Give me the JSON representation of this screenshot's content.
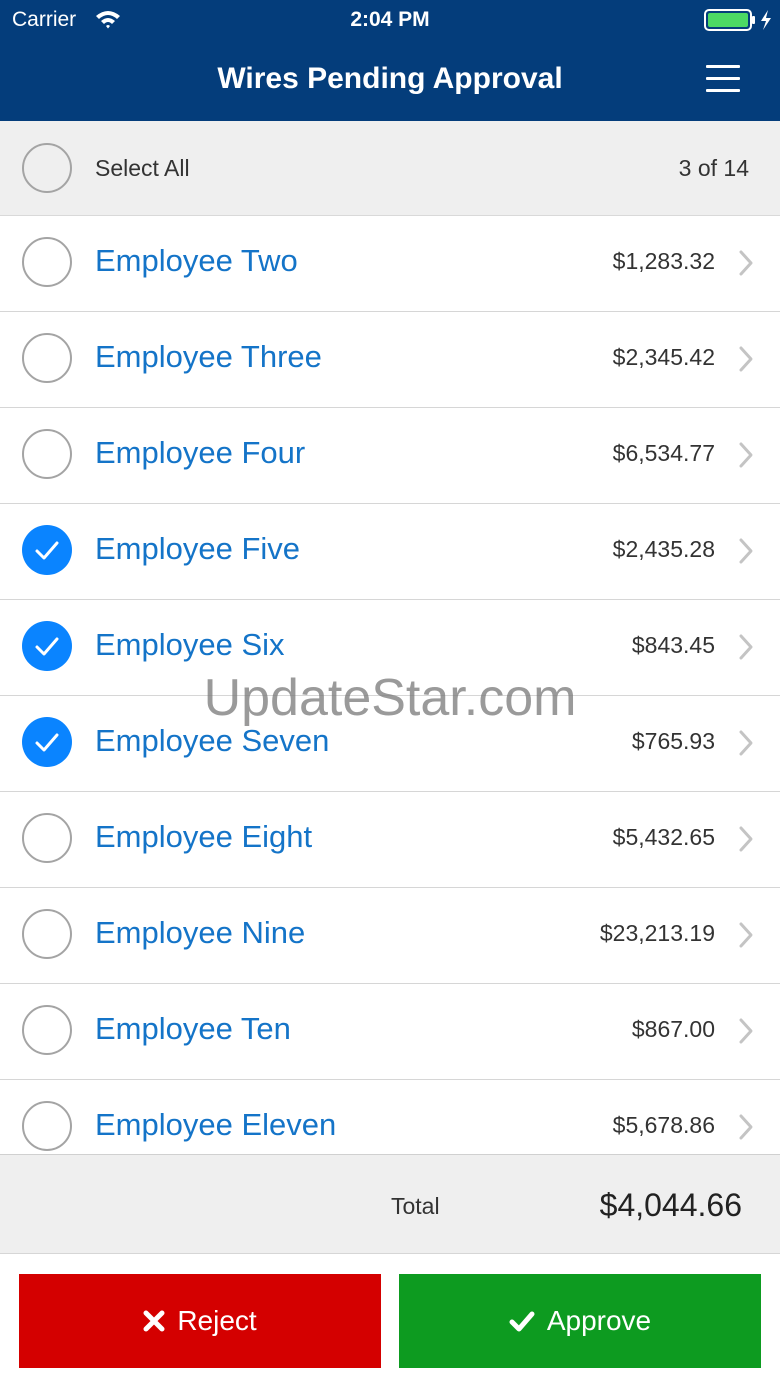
{
  "status_bar": {
    "carrier": "Carrier",
    "time": "2:04 PM"
  },
  "header": {
    "title": "Wires Pending Approval",
    "menu_icon": "hamburger-menu-icon"
  },
  "select_all": {
    "label": "Select All",
    "count": "3 of 14"
  },
  "items": [
    {
      "name": "Employee Two",
      "amount": "$1,283.32",
      "checked": false
    },
    {
      "name": "Employee Three",
      "amount": "$2,345.42",
      "checked": false
    },
    {
      "name": "Employee Four",
      "amount": "$6,534.77",
      "checked": false
    },
    {
      "name": "Employee Five",
      "amount": "$2,435.28",
      "checked": true
    },
    {
      "name": "Employee Six",
      "amount": "$843.45",
      "checked": true
    },
    {
      "name": "Employee Seven",
      "amount": "$765.93",
      "checked": true
    },
    {
      "name": "Employee Eight",
      "amount": "$5,432.65",
      "checked": false
    },
    {
      "name": "Employee Nine",
      "amount": "$23,213.19",
      "checked": false
    },
    {
      "name": "Employee Ten",
      "amount": "$867.00",
      "checked": false
    },
    {
      "name": "Employee Eleven",
      "amount": "$5,678.86",
      "checked": false
    }
  ],
  "total": {
    "label": "Total",
    "value": "$4,044.66"
  },
  "actions": {
    "reject_label": "Reject",
    "approve_label": "Approve"
  },
  "watermark": "UpdateStar.com",
  "colors": {
    "header": "#043d7b",
    "accent": "#0a84ff",
    "link": "#1474c8",
    "reject": "#d40000",
    "approve": "#0d9b20"
  }
}
